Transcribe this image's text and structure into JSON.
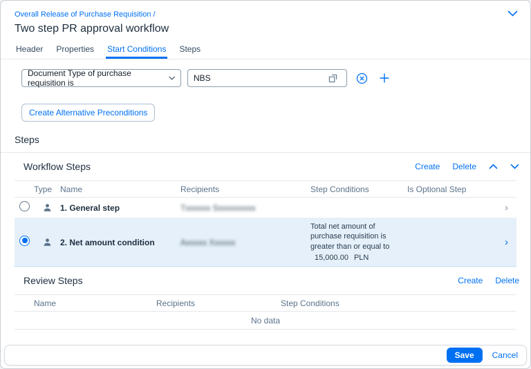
{
  "header": {
    "breadcrumb": "Overall Release of Purchase Requisition /",
    "title": "Two step PR approval workflow"
  },
  "tabs": [
    {
      "label": "Header"
    },
    {
      "label": "Properties"
    },
    {
      "label": "Start Conditions"
    },
    {
      "label": "Steps"
    }
  ],
  "start_conditions": {
    "condition_type": "Document Type of purchase requisition is",
    "condition_value": "NBS",
    "alt_preconditions_button": "Create Alternative Preconditions"
  },
  "steps": {
    "section_title": "Steps",
    "workflow": {
      "title": "Workflow Steps",
      "create_label": "Create",
      "delete_label": "Delete",
      "columns": {
        "type": "Type",
        "name": "Name",
        "recipients": "Recipients",
        "step_conditions": "Step Conditions",
        "is_optional": "Is Optional Step"
      },
      "rows": [
        {
          "name": "1. General step",
          "recipients_redacted": "Txxxxxx Sxxxxxxxxx",
          "step_conditions": "",
          "is_optional": ""
        },
        {
          "name": "2. Net amount condition",
          "recipients_redacted": "Axxxxx Xxxxxx",
          "step_conditions": "Total net amount of purchase requisition is greater than or equal to",
          "amount": "15,000.00",
          "currency": "PLN",
          "is_optional": ""
        }
      ]
    },
    "review": {
      "title": "Review Steps",
      "create_label": "Create",
      "delete_label": "Delete",
      "columns": {
        "name": "Name",
        "recipients": "Recipients",
        "step_conditions": "Step Conditions"
      },
      "no_data": "No data"
    }
  },
  "footer": {
    "save": "Save",
    "cancel": "Cancel"
  },
  "colors": {
    "accent": "#0070f2",
    "selected_row": "#e5f0fa"
  }
}
